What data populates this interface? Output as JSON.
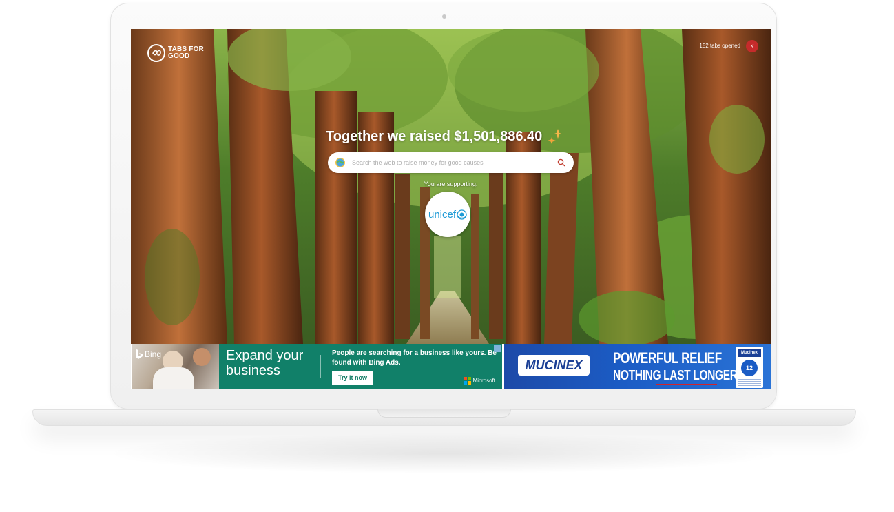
{
  "brand": {
    "name": "TABS FOR GOOD"
  },
  "header": {
    "tabs_opened": "152 tabs opened",
    "avatar_initial": "K"
  },
  "hero": {
    "raised_text": "Together we raised $1,501,886.40"
  },
  "search": {
    "placeholder": "Search the web to raise money for good causes",
    "value": ""
  },
  "charity": {
    "label": "You are supporting:",
    "name": "unicef"
  },
  "ads": {
    "bing": {
      "brand": "Bing",
      "headline": "Expand your business",
      "body": "People are searching for a business like yours. Be found with Bing Ads.",
      "cta": "Try it now",
      "sponsor": "Microsoft"
    },
    "mucinex": {
      "brand": "MUCINEX",
      "line1": "POWERFUL RELIEF",
      "line2": "NOTHING LAST LONGER",
      "box_brand": "Mucinex",
      "box_badge": "12"
    }
  },
  "colors": {
    "bing_ad_bg": "#118069",
    "mucinex_bg": "#1b5cc5",
    "avatar": "#c52b2b",
    "unicef": "#1c9ad6"
  }
}
